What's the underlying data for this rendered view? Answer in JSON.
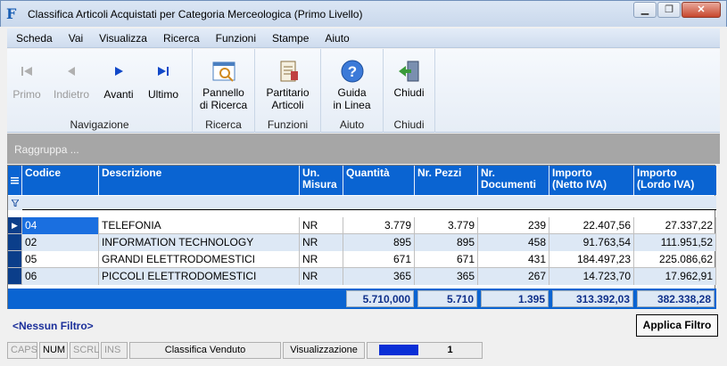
{
  "window": {
    "title": "Classifica Articoli Acquistati per Categoria Merceologica (Primo Livello)",
    "app_icon_glyph": "F",
    "min_glyph": "▁",
    "restore_glyph": "❐",
    "close_glyph": "✕"
  },
  "menu": [
    "Scheda",
    "Vai",
    "Visualizza",
    "Ricerca",
    "Funzioni",
    "Stampe",
    "Aiuto"
  ],
  "ribbon": {
    "nav": {
      "caption": "Navigazione",
      "primo": "Primo",
      "indietro": "Indietro",
      "avanti": "Avanti",
      "ultimo": "Ultimo"
    },
    "ricerca": {
      "caption": "Ricerca",
      "line1": "Pannello",
      "line2": "di Ricerca"
    },
    "funzioni": {
      "caption": "Funzioni",
      "line1": "Partitario",
      "line2": "Articoli"
    },
    "aiuto": {
      "caption": "Aiuto",
      "line1": "Guida",
      "line2": "in Linea"
    },
    "chiudi": {
      "caption": "Chiudi",
      "line1": "Chiudi"
    }
  },
  "groupbar": {
    "label": "Raggruppa ..."
  },
  "grid": {
    "columns": {
      "codice": "Codice",
      "descrizione": "Descrizione",
      "um1": "Un.",
      "um2": "Misura",
      "quantita": "Quantità",
      "pezzi": "Nr. Pezzi",
      "doc1": "Nr.",
      "doc2": "Documenti",
      "netto1": "Importo",
      "netto2": "(Netto IVA)",
      "lordo1": "Importo",
      "lordo2": "(Lordo IVA)"
    },
    "rows": [
      {
        "codice": "04",
        "descrizione": "TELEFONIA",
        "um": "NR",
        "quantita": "3.779",
        "pezzi": "3.779",
        "documenti": "239",
        "netto": "22.407,56",
        "lordo": "27.337,22"
      },
      {
        "codice": "02",
        "descrizione": "INFORMATION TECHNOLOGY",
        "um": "NR",
        "quantita": "895",
        "pezzi": "895",
        "documenti": "458",
        "netto": "91.763,54",
        "lordo": "111.951,52"
      },
      {
        "codice": "05",
        "descrizione": "GRANDI ELETTRODOMESTICI",
        "um": "NR",
        "quantita": "671",
        "pezzi": "671",
        "documenti": "431",
        "netto": "184.497,23",
        "lordo": "225.086,62"
      },
      {
        "codice": "06",
        "descrizione": "PICCOLI ELETTRODOMESTICI",
        "um": "NR",
        "quantita": "365",
        "pezzi": "365",
        "documenti": "267",
        "netto": "14.723,70",
        "lordo": "17.962,91"
      }
    ],
    "totals": {
      "quantita": "5.710,000",
      "pezzi": "5.710",
      "documenti": "1.395",
      "netto": "313.392,03",
      "lordo": "382.338,28"
    }
  },
  "filter": {
    "none_label": "<Nessun Filtro>",
    "apply_label": "Applica Filtro"
  },
  "statusbar": {
    "caps": "CAPS",
    "num": "NUM",
    "scrl": "SCRL",
    "ins": "INS",
    "context": "Classifica Venduto",
    "mode": "Visualizzazione",
    "page": "1"
  }
}
